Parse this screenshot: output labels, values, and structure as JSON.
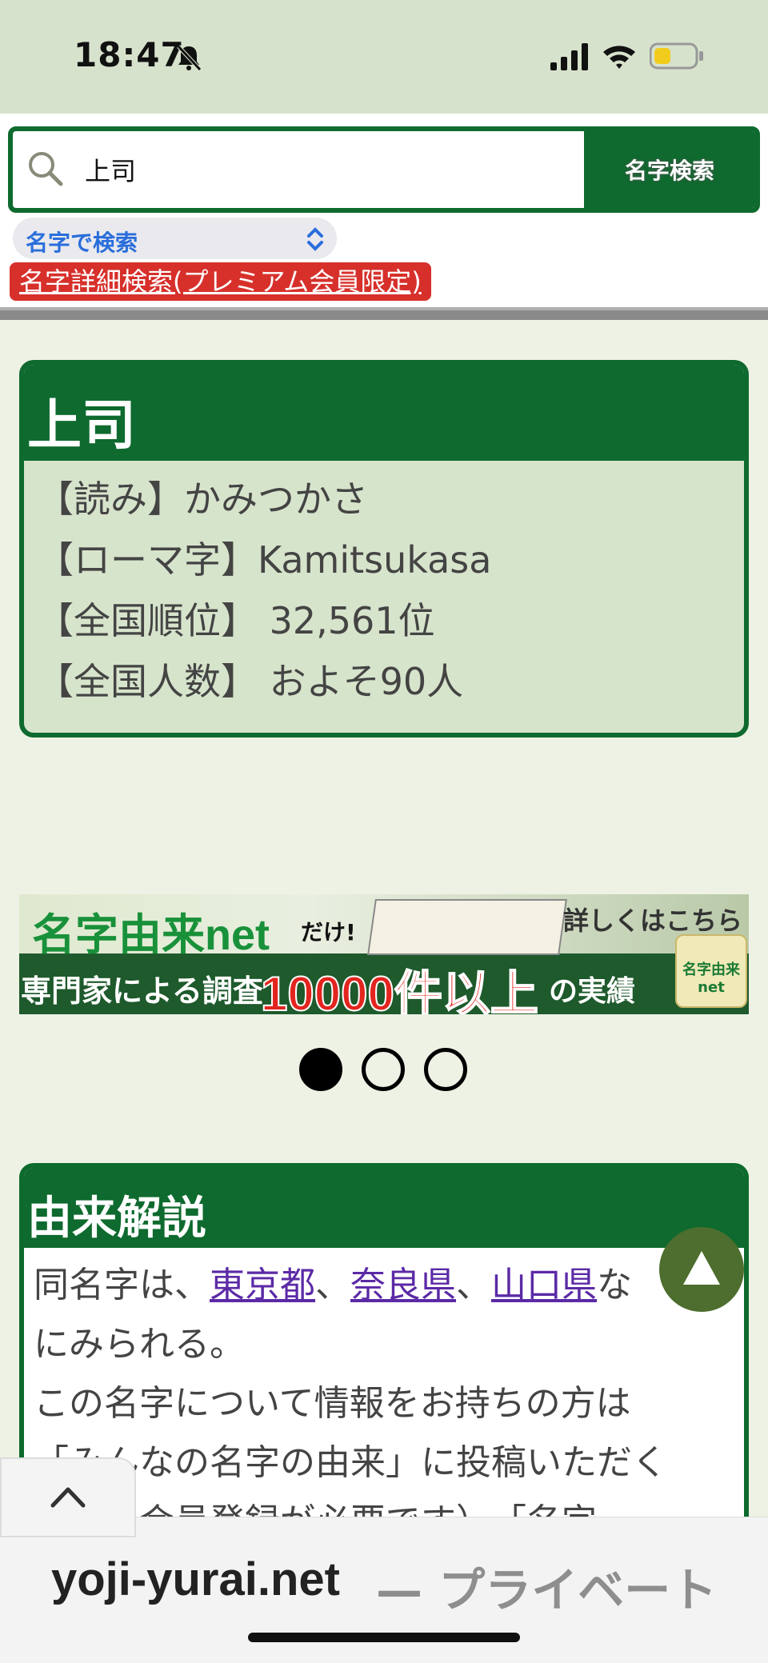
{
  "status_bar": {
    "time": "18:47"
  },
  "search": {
    "query": "上司",
    "button_label": "名字検索",
    "mode_label": "名字で検索",
    "premium_link": "名字詳細検索(プレミアム会員限定)"
  },
  "surname": {
    "name": "上司",
    "rows": [
      "【読み】かみつかさ",
      "【ローマ字】Kamitsukasa",
      "【全国順位】 32,561位",
      "【全国人数】 およそ90人"
    ]
  },
  "banner": {
    "title": "名字由来net",
    "dake": "だけ!",
    "detail": "詳しくはこちら",
    "left_text": "専門家による調査",
    "count_text": "10000件以上",
    "result_text": "の実績",
    "logo_text_1": "名字由来",
    "logo_text_2": "net"
  },
  "pager": {
    "active_index": 0,
    "count": 3
  },
  "origin": {
    "title": "由来解説",
    "line1_prefix": "同名字は、",
    "link1": "東京都",
    "sep1": "、",
    "link2": "奈良県",
    "sep2": "、",
    "link3": "山口県",
    "line1_suffix": "な",
    "line2": "にみられる。",
    "line3": "この名字について情報をお持ちの方は",
    "line4": "「みんなの名字の由来」に投稿いただく",
    "line5": "（無料会員登録が必要です）。「名字"
  },
  "browser": {
    "domain": "yoji-yurai.net",
    "mode": " — プライベート"
  },
  "colors": {
    "brand_green": "#0e6a2e",
    "card_fill": "#d7e4cc",
    "link_purple": "#5b2aa6",
    "premium_red": "#d7302b"
  }
}
